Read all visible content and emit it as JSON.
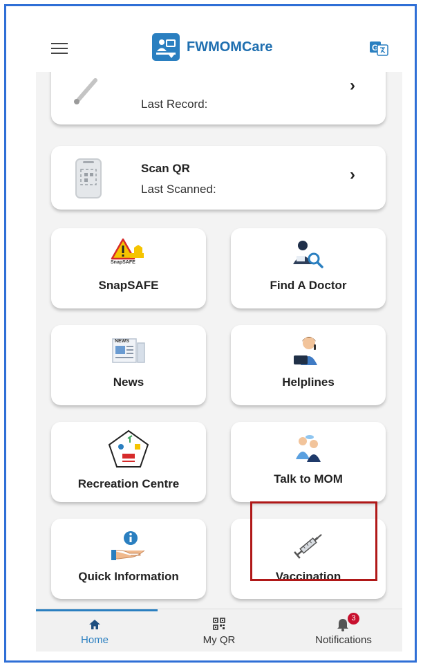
{
  "header": {
    "app_name": "FWMOMCare",
    "menu_icon": "hamburger-menu-icon",
    "translate_icon": "translate-icon"
  },
  "top_cards": [
    {
      "title": "",
      "subtitle": "Last Record:",
      "icon": "thermometer-icon"
    },
    {
      "title": "Scan QR",
      "subtitle": "Last Scanned:",
      "icon": "qr-scanner-icon"
    }
  ],
  "tiles": [
    {
      "label": "SnapSAFE",
      "icon": "snapsafe-warning-icon",
      "icon_caption": "SnapSAFE"
    },
    {
      "label": "Find A Doctor",
      "icon": "doctor-search-icon"
    },
    {
      "label": "News",
      "icon": "newspaper-icon",
      "icon_caption": "NEWS"
    },
    {
      "label": "Helplines",
      "icon": "helpline-agent-icon"
    },
    {
      "label": "Recreation Centre",
      "icon": "recreation-centre-icon"
    },
    {
      "label": "Talk to MOM",
      "icon": "talk-people-icon"
    },
    {
      "label": "Quick Information",
      "icon": "info-hand-icon"
    },
    {
      "label": "Vaccination",
      "icon": "syringe-icon"
    }
  ],
  "bottom_nav": {
    "items": [
      {
        "label": "Home",
        "icon": "home-icon",
        "active": true
      },
      {
        "label": "My QR",
        "icon": "qr-code-icon",
        "active": false
      },
      {
        "label": "Notifications",
        "icon": "bell-icon",
        "active": false,
        "badge": "3"
      }
    ]
  },
  "colors": {
    "accent": "#2a7fc0",
    "highlight_border": "#b01818",
    "badge": "#c8102e",
    "frame_border": "#2f6fd6"
  }
}
